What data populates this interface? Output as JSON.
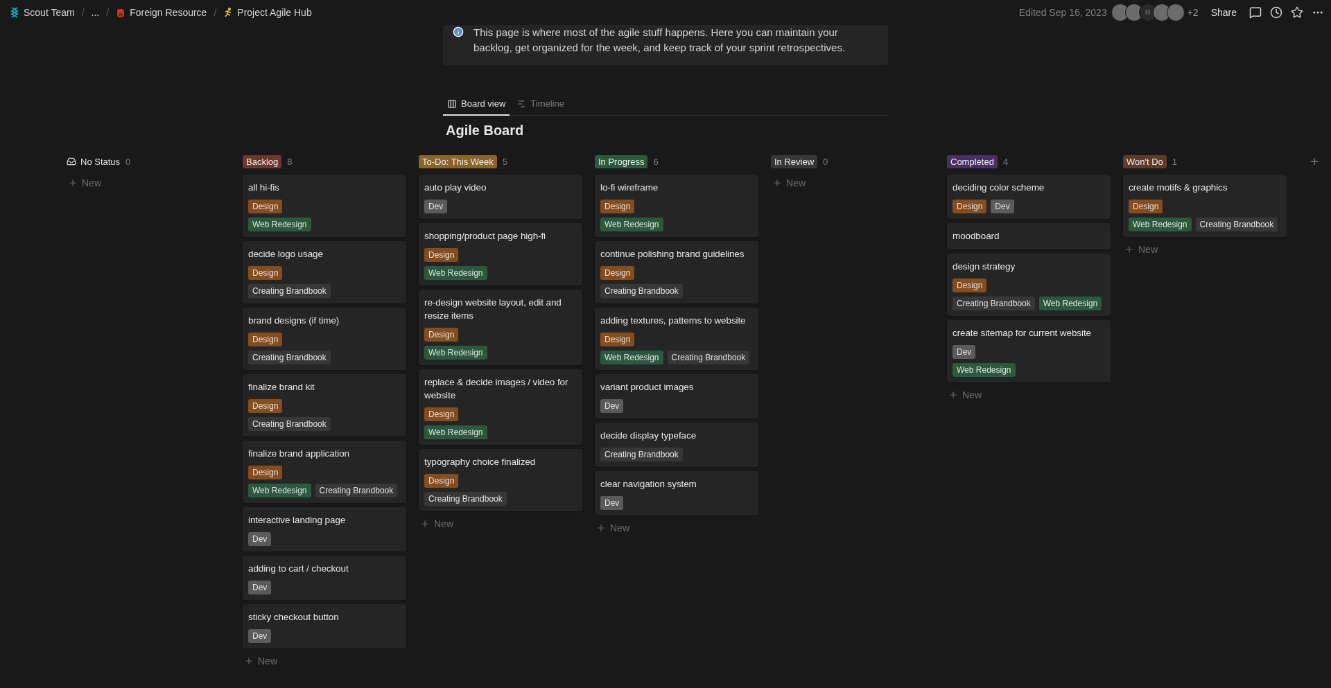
{
  "breadcrumbs": [
    {
      "label": "Scout Team"
    },
    {
      "sep": "/",
      "label": "..."
    },
    {
      "sep": "/",
      "label": "Foreign Resource"
    },
    {
      "sep": "/",
      "label": "Project Agile Hub"
    }
  ],
  "topbar": {
    "edited": "Edited Sep 16, 2023",
    "avatars": [
      {
        "kind": "photo"
      },
      {
        "kind": "photo"
      },
      {
        "kind": "letter",
        "letter": "R"
      },
      {
        "kind": "photo"
      },
      {
        "kind": "photo"
      }
    ],
    "more_count": "+2",
    "share": "Share"
  },
  "callout": {
    "text": "This page is where most of the agile stuff happens. Here you can maintain your backlog, get organized for the week, and keep track of your sprint retrospectives."
  },
  "views": [
    {
      "label": "Board view",
      "selected": true
    },
    {
      "label": "Timeline",
      "selected": false
    }
  ],
  "board_title": "Agile Board",
  "columns": [
    {
      "name": "No Status",
      "count": "0",
      "new_label": "New"
    },
    {
      "name": "Backlog",
      "count": "8",
      "color": "#6e3630",
      "new_label": "New",
      "cards": [
        {
          "title": "all hi-fis",
          "tag_rows": [
            [
              {
                "label": "Design",
                "color": "#854c1d"
              }
            ],
            [
              {
                "label": "Web Redesign",
                "color": "#2b593f"
              }
            ]
          ]
        },
        {
          "title": "decide logo usage",
          "tag_rows": [
            [
              {
                "label": "Design",
                "color": "#854c1d"
              }
            ],
            [
              {
                "label": "Creating Brandbook",
                "color": "#373737"
              }
            ]
          ]
        },
        {
          "title": "brand designs (if time)",
          "tag_rows": [
            [
              {
                "label": "Design",
                "color": "#854c1d"
              }
            ],
            [
              {
                "label": "Creating Brandbook",
                "color": "#373737"
              }
            ]
          ]
        },
        {
          "title": "finalize brand kit",
          "tag_rows": [
            [
              {
                "label": "Design",
                "color": "#854c1d"
              }
            ],
            [
              {
                "label": "Creating Brandbook",
                "color": "#373737"
              }
            ]
          ]
        },
        {
          "title": "finalize brand application",
          "tag_rows": [
            [
              {
                "label": "Design",
                "color": "#854c1d"
              }
            ],
            [
              {
                "label": "Web Redesign",
                "color": "#2b593f"
              },
              {
                "label": "Creating Brandbook",
                "color": "#373737"
              }
            ]
          ]
        },
        {
          "title": "interactive landing page",
          "tag_rows": [
            [
              {
                "label": "Dev",
                "color": "#5a5a5a"
              }
            ]
          ]
        },
        {
          "title": "adding to cart / checkout",
          "tag_rows": [
            [
              {
                "label": "Dev",
                "color": "#5a5a5a"
              }
            ]
          ]
        },
        {
          "title": "sticky checkout button",
          "tag_rows": [
            [
              {
                "label": "Dev",
                "color": "#5a5a5a"
              }
            ]
          ]
        }
      ]
    },
    {
      "name": "To-Do: This Week",
      "count": "5",
      "color": "#89632a",
      "new_label": "New",
      "cards": [
        {
          "title": "auto play video",
          "tag_rows": [
            [
              {
                "label": "Dev",
                "color": "#5a5a5a"
              }
            ]
          ]
        },
        {
          "title": "shopping/product page high-fi",
          "tag_rows": [
            [
              {
                "label": "Design",
                "color": "#854c1d"
              }
            ],
            [
              {
                "label": "Web Redesign",
                "color": "#2b593f"
              }
            ]
          ]
        },
        {
          "title": "re-design website layout, edit and resize items",
          "tag_rows": [
            [
              {
                "label": "Design",
                "color": "#854c1d"
              }
            ],
            [
              {
                "label": "Web Redesign",
                "color": "#2b593f"
              }
            ]
          ]
        },
        {
          "title": "replace & decide images / video for website",
          "tag_rows": [
            [
              {
                "label": "Design",
                "color": "#854c1d"
              }
            ],
            [
              {
                "label": "Web Redesign",
                "color": "#2b593f"
              }
            ]
          ]
        },
        {
          "title": "typography choice finalized",
          "tag_rows": [
            [
              {
                "label": "Design",
                "color": "#854c1d"
              }
            ],
            [
              {
                "label": "Creating Brandbook",
                "color": "#373737"
              }
            ]
          ]
        }
      ]
    },
    {
      "name": "In Progress",
      "count": "6",
      "color": "#2b593f",
      "new_label": "New",
      "cards": [
        {
          "title": "lo-fi wireframe",
          "tag_rows": [
            [
              {
                "label": "Design",
                "color": "#854c1d"
              }
            ],
            [
              {
                "label": "Web Redesign",
                "color": "#2b593f"
              }
            ]
          ]
        },
        {
          "title": "continue polishing brand guidelines",
          "tag_rows": [
            [
              {
                "label": "Design",
                "color": "#854c1d"
              }
            ],
            [
              {
                "label": "Creating Brandbook",
                "color": "#373737"
              }
            ]
          ]
        },
        {
          "title": "adding textures, patterns to website",
          "tag_rows": [
            [
              {
                "label": "Design",
                "color": "#854c1d"
              }
            ],
            [
              {
                "label": "Web Redesign",
                "color": "#2b593f"
              },
              {
                "label": "Creating Brandbook",
                "color": "#373737"
              }
            ]
          ]
        },
        {
          "title": "variant product images",
          "tag_rows": [
            [
              {
                "label": "Dev",
                "color": "#5a5a5a"
              }
            ]
          ]
        },
        {
          "title": "decide display typeface",
          "tag_rows": [
            [
              {
                "label": "Creating Brandbook",
                "color": "#373737"
              }
            ]
          ]
        },
        {
          "title": "clear navigation system",
          "tag_rows": [
            [
              {
                "label": "Dev",
                "color": "#5a5a5a"
              }
            ]
          ]
        }
      ]
    },
    {
      "name": "In Review",
      "count": "0",
      "color": "#373737",
      "new_label": "New"
    },
    {
      "name": "Completed",
      "count": "4",
      "color": "#492f64",
      "new_label": "New",
      "cards": [
        {
          "title": "deciding color scheme",
          "tag_rows": [
            [
              {
                "label": "Design",
                "color": "#854c1d"
              },
              {
                "label": "Dev",
                "color": "#5a5a5a"
              }
            ]
          ]
        },
        {
          "title": "moodboard"
        },
        {
          "title": "design strategy",
          "tag_rows": [
            [
              {
                "label": "Design",
                "color": "#854c1d"
              }
            ],
            [
              {
                "label": "Creating Brandbook",
                "color": "#373737"
              },
              {
                "label": "Web Redesign",
                "color": "#2b593f"
              }
            ]
          ]
        },
        {
          "title": "create sitemap for current website",
          "tag_rows": [
            [
              {
                "label": "Dev",
                "color": "#5a5a5a"
              }
            ],
            [
              {
                "label": "Web Redesign",
                "color": "#2b593f"
              }
            ]
          ]
        }
      ]
    },
    {
      "name": "Won't Do",
      "count": "1",
      "color": "#603b2c",
      "new_label": "New",
      "cards": [
        {
          "title": "create motifs & graphics",
          "tag_rows": [
            [
              {
                "label": "Design",
                "color": "#854c1d"
              }
            ],
            [
              {
                "label": "Web Redesign",
                "color": "#2b593f"
              },
              {
                "label": "Creating Brandbook",
                "color": "#373737"
              }
            ]
          ]
        }
      ]
    }
  ]
}
